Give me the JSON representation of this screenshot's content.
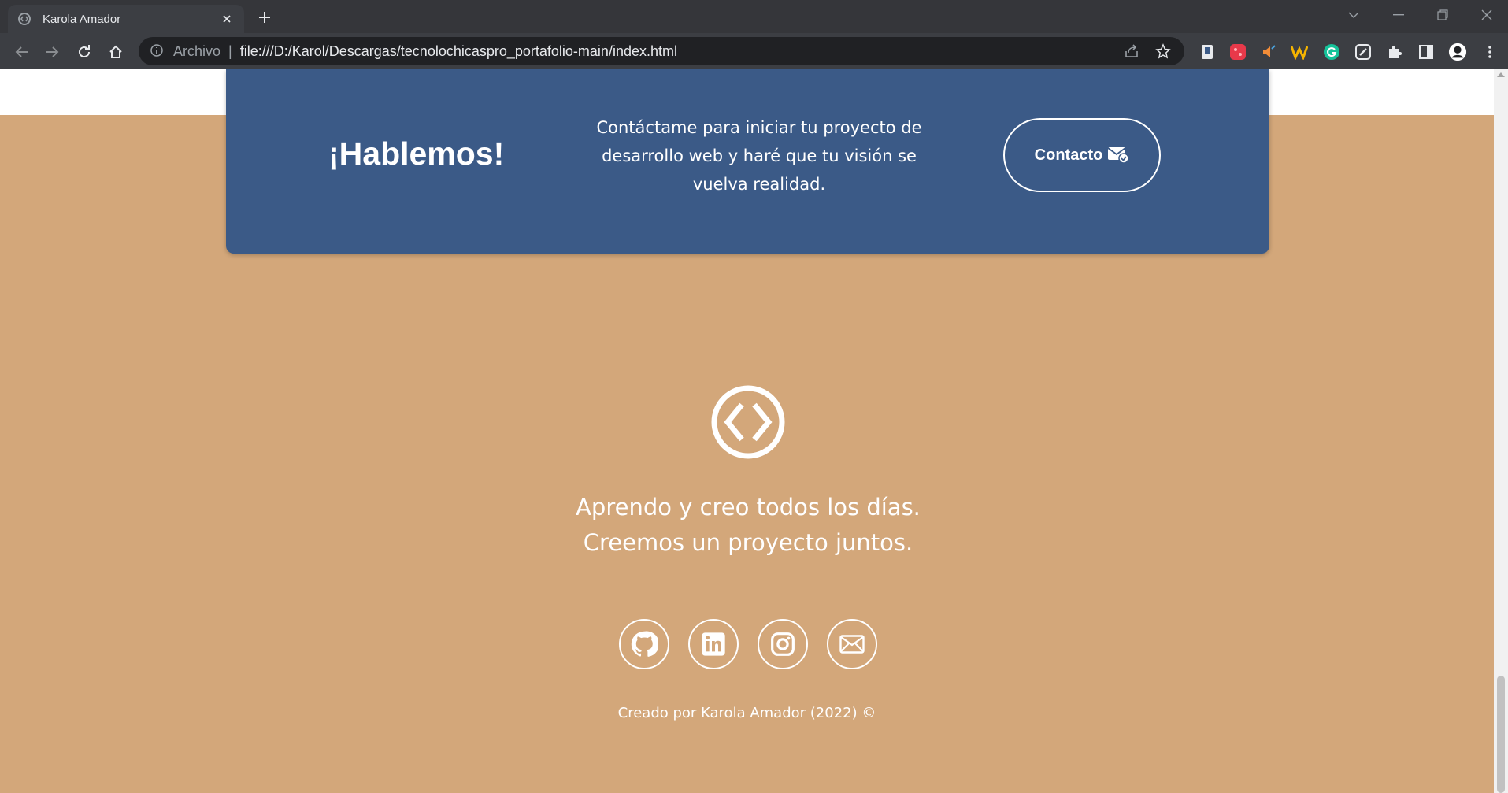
{
  "browser": {
    "tab_title": "Karola Amador",
    "scheme_label": "Archivo",
    "url": "file:///D:/Karol/Descargas/tecnolochicaspro_portafolio-main/index.html"
  },
  "cta": {
    "heading": "¡Hablemos!",
    "text": "Contáctame para iniciar tu proyecto de desarrollo web y haré que tu visión se vuelva realidad.",
    "button_label": "Contacto"
  },
  "footer": {
    "tagline_line1": "Aprendo y creo todos los días.",
    "tagline_line2": "Creemos un proyecto juntos.",
    "socials": [
      "github-icon",
      "linkedin-icon",
      "instagram-icon",
      "email-icon"
    ],
    "credit": "Creado por Karola Amador (2022) ©"
  },
  "colors": {
    "footer_bg": "#d3a77a",
    "cta_bg": "#3b5a87",
    "text": "#ffffff"
  }
}
